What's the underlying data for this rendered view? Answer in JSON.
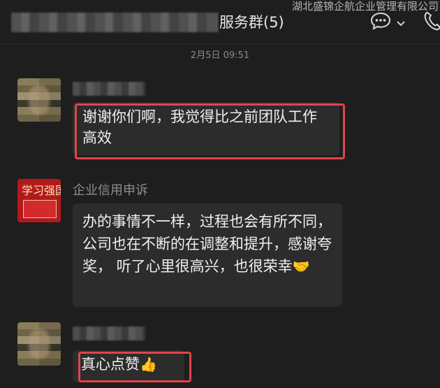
{
  "watermark": "湖北盛锦企航企业管理有限公司",
  "header": {
    "title_suffix": "服务群(5)",
    "icons": [
      "chat-bubble-icon",
      "chevron-down-icon",
      "phone-icon"
    ]
  },
  "date": "2月5日 09:51",
  "messages": [
    {
      "sender": "",
      "avatar": "pixelated-avatar",
      "text": "谢谢你们啊，我觉得比之前团队工作高效",
      "highlighted": true
    },
    {
      "sender": "企业信用申诉",
      "avatar": "red-logo-avatar",
      "avatar_text": "学习强国",
      "text": "办的事情不一样，过程也会有所不同，公司也在不断的在调整和提升，感谢夸奖， 听了心里很高兴，也很荣幸",
      "emoji": "🤝",
      "highlighted": false
    },
    {
      "sender": "",
      "avatar": "pixelated-avatar",
      "text": "真心点赞",
      "emoji": "👍",
      "highlighted": true
    }
  ],
  "colors": {
    "background": "#1e1e1e",
    "bubble": "#2c2c2c",
    "highlight": "#e2444b"
  }
}
